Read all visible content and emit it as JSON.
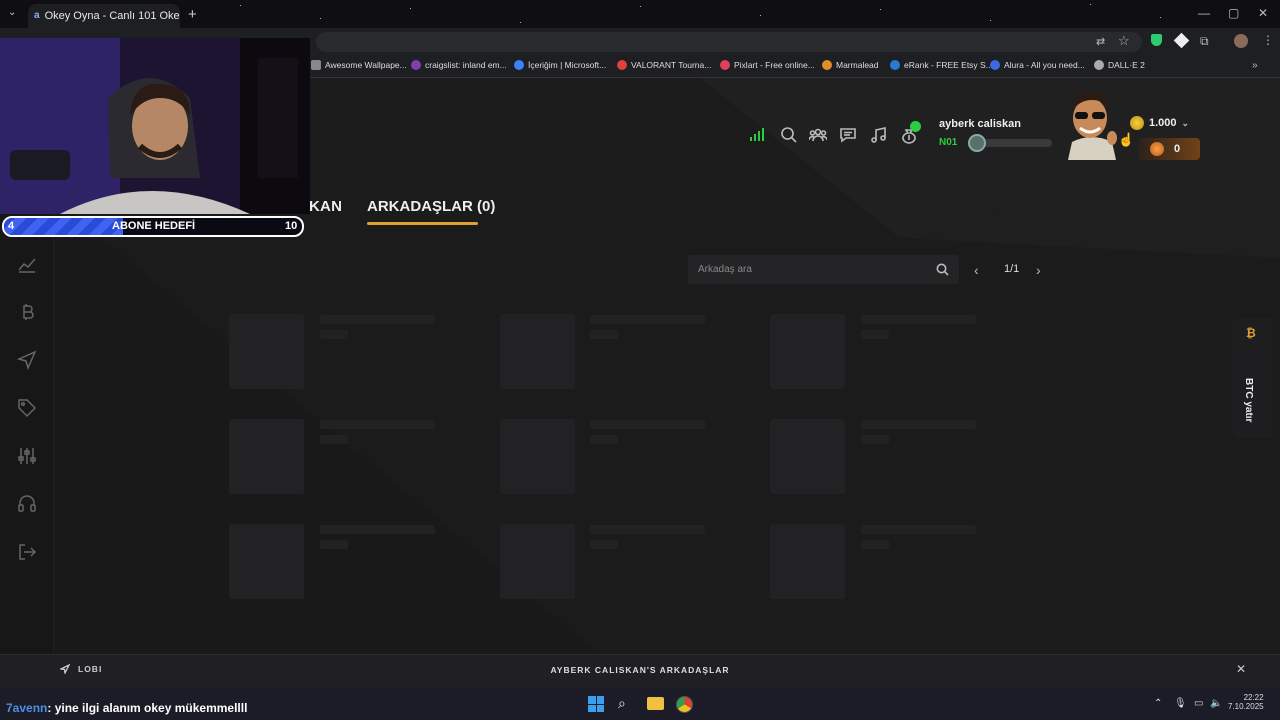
{
  "browser": {
    "tab_title": "Okey Oyna - Canlı 101 Oke",
    "bookmarks": [
      {
        "label": "Awesome Wallpape...",
        "color": "#888"
      },
      {
        "label": "craigslist: inland em...",
        "color": "#7b3fb0"
      },
      {
        "label": "İçeriğim | Microsoft...",
        "color": "#3b82f6"
      },
      {
        "label": "VALORANT Tourna...",
        "color": "#e04040"
      },
      {
        "label": "Pixlart - Free online...",
        "color": "#e0405a"
      },
      {
        "label": "Marmalead",
        "color": "#e0902a"
      },
      {
        "label": "eRank - FREE Etsy S...",
        "color": "#2a7bd0"
      },
      {
        "label": "Alura - All you need...",
        "color": "#3a6ae0"
      },
      {
        "label": "DALL·E 2",
        "color": "#aaa"
      }
    ]
  },
  "header": {
    "username": "ayberk caliskan",
    "level": "N01",
    "coins": "1.000",
    "chips": "0",
    "xp_progress": 0.0
  },
  "tabs": {
    "first_partial": "KAN",
    "friends": "ARKADAŞLAR (0)"
  },
  "search": {
    "placeholder": "Arkadaş ara"
  },
  "pagination": {
    "page": "1/1"
  },
  "side_panel": {
    "btc_label": "BTC yatır",
    "btc_icon": "₿"
  },
  "bottom": {
    "lobby": "LOBI",
    "title": "AYBERK CALISKAN'S ARKADAŞLAR"
  },
  "overlay": {
    "goal_label": "ABONE HEDEFİ",
    "goal_current": "4",
    "goal_max": "10",
    "goal_progress": 0.4
  },
  "chat": {
    "nick": "7avenn",
    "message": ": yine ilgi alanım okey mükemmellll"
  },
  "taskbar": {
    "time": "22:22",
    "date": "7.10.2025"
  },
  "colors": {
    "accent": "#e0a030",
    "online": "#2ecc40"
  }
}
